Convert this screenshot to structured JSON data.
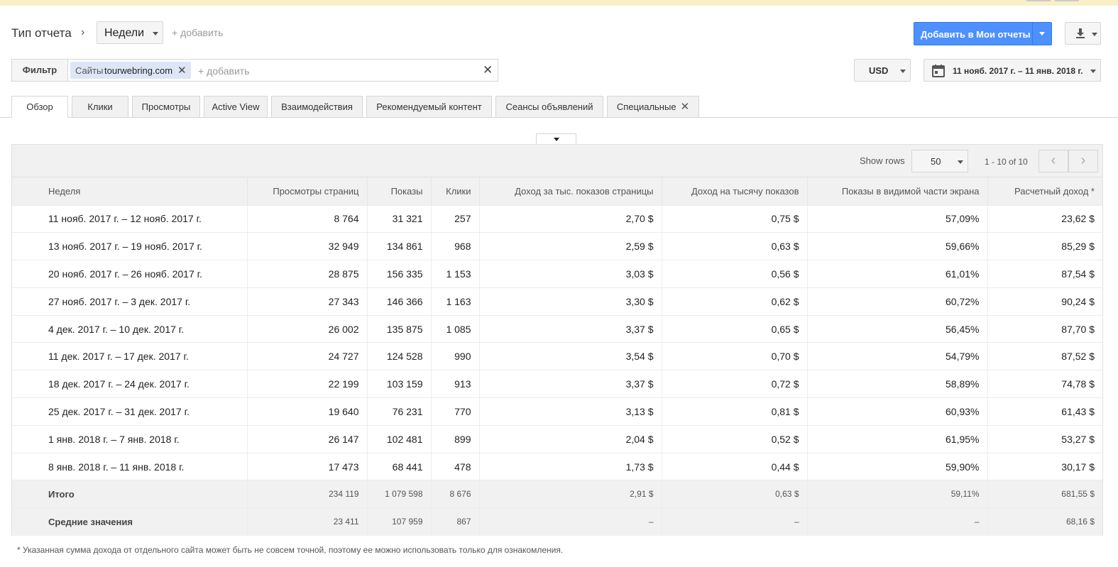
{
  "header": {
    "report_type_label": "Тип отчета",
    "dimension": "Недели",
    "add_dimension": "+ добавить",
    "add_to_reports_label": "Добавить в Мои отчеты"
  },
  "filter": {
    "label": "Фильтр",
    "chip_key": "Сайты",
    "chip_value": "tourwebring.com",
    "add_placeholder": "+ добавить"
  },
  "currency": "USD",
  "date_range": "11 нояб. 2017 г. – 11 янв. 2018 г.",
  "tabs": [
    {
      "label": "Обзор"
    },
    {
      "label": "Клики"
    },
    {
      "label": "Просмотры"
    },
    {
      "label": "Active View"
    },
    {
      "label": "Взаимодействия"
    },
    {
      "label": "Рекомендуемый контент"
    },
    {
      "label": "Сеансы объявлений"
    },
    {
      "label": "Специальные"
    }
  ],
  "pager": {
    "show_rows_label": "Show rows",
    "rows_value": "50",
    "range_text": "1 - 10 of 10"
  },
  "table": {
    "columns": [
      "Неделя",
      "Просмотры страниц",
      "Показы",
      "Клики",
      "Доход за тыс. показов страницы",
      "Доход на тысячу показов",
      "Показы в видимой части экрана",
      "Расчетный доход *"
    ],
    "rows": [
      [
        "11 нояб. 2017 г. – 12 нояб. 2017 г.",
        "8 764",
        "31 321",
        "257",
        "2,70 $",
        "0,75 $",
        "57,09%",
        "23,62 $"
      ],
      [
        "13 нояб. 2017 г. – 19 нояб. 2017 г.",
        "32 949",
        "134 861",
        "968",
        "2,59 $",
        "0,63 $",
        "59,66%",
        "85,29 $"
      ],
      [
        "20 нояб. 2017 г. – 26 нояб. 2017 г.",
        "28 875",
        "156 335",
        "1 153",
        "3,03 $",
        "0,56 $",
        "61,01%",
        "87,54 $"
      ],
      [
        "27 нояб. 2017 г. – 3 дек. 2017 г.",
        "27 343",
        "146 366",
        "1 163",
        "3,30 $",
        "0,62 $",
        "60,72%",
        "90,24 $"
      ],
      [
        "4 дек. 2017 г. – 10 дек. 2017 г.",
        "26 002",
        "135 875",
        "1 085",
        "3,37 $",
        "0,65 $",
        "56,45%",
        "87,70 $"
      ],
      [
        "11 дек. 2017 г. – 17 дек. 2017 г.",
        "24 727",
        "124 528",
        "990",
        "3,54 $",
        "0,70 $",
        "54,79%",
        "87,52 $"
      ],
      [
        "18 дек. 2017 г. – 24 дек. 2017 г.",
        "22 199",
        "103 159",
        "913",
        "3,37 $",
        "0,72 $",
        "58,89%",
        "74,78 $"
      ],
      [
        "25 дек. 2017 г. – 31 дек. 2017 г.",
        "19 640",
        "76 231",
        "770",
        "3,13 $",
        "0,81 $",
        "60,93%",
        "61,43 $"
      ],
      [
        "1 янв. 2018 г. – 7 янв. 2018 г.",
        "26 147",
        "102 481",
        "899",
        "2,04 $",
        "0,52 $",
        "61,95%",
        "53,27 $"
      ],
      [
        "8 янв. 2018 г. – 11 янв. 2018 г.",
        "17 473",
        "68 441",
        "478",
        "1,73 $",
        "0,44 $",
        "59,90%",
        "30,17 $"
      ]
    ],
    "totals": [
      "Итого",
      "234 119",
      "1 079 598",
      "8 676",
      "2,91 $",
      "0,63 $",
      "59,11%",
      "681,55 $"
    ],
    "averages": [
      "Средние значения",
      "23 411",
      "107 959",
      "867",
      "–",
      "–",
      "–",
      "68,16 $"
    ]
  },
  "footnote": "* Указанная сумма дохода от отдельного сайта может быть не совсем точной, поэтому ее можно использовать только для ознакомления.",
  "colors": {
    "accent_blue": "#4d90fe",
    "top_banner": "#f9f0c8",
    "chip_bg": "#dde6f7"
  },
  "icons": {
    "download": "download-icon",
    "calendar": "calendar-icon",
    "close": "close-icon"
  }
}
